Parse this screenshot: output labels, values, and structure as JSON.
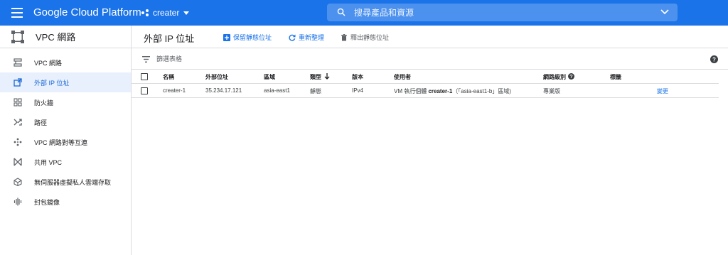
{
  "header": {
    "brand": "Google Cloud Platform",
    "project": "creater",
    "search_placeholder": "搜尋產品和資源"
  },
  "sidebar": {
    "title": "VPC 網路",
    "items": [
      {
        "label": "VPC 網路",
        "icon": "vpc-network-icon",
        "active": false
      },
      {
        "label": "外部 IP 位址",
        "icon": "external-ip-icon",
        "active": true
      },
      {
        "label": "防火牆",
        "icon": "firewall-icon",
        "active": false
      },
      {
        "label": "路徑",
        "icon": "routes-icon",
        "active": false
      },
      {
        "label": "VPC 網路對等互連",
        "icon": "vpc-peering-icon",
        "active": false
      },
      {
        "label": "共用 VPC",
        "icon": "shared-vpc-icon",
        "active": false
      },
      {
        "label": "無伺服器虛擬私人雲端存取",
        "icon": "serverless-vpc-access-icon",
        "active": false
      },
      {
        "label": "封包鏡像",
        "icon": "packet-mirroring-icon",
        "active": false
      }
    ]
  },
  "toolbar": {
    "page_title": "外部 IP 位址",
    "reserve_label": "保留靜態位址",
    "refresh_label": "重新整理",
    "release_label": "釋出靜態位址"
  },
  "filter": {
    "placeholder": "篩選表格"
  },
  "table": {
    "headers": {
      "name": "名稱",
      "external_address": "外部位址",
      "region": "區域",
      "type": "類型",
      "version": "版本",
      "used_by": "使用者",
      "network_tier": "網路級別",
      "labels": "標籤"
    },
    "rows": [
      {
        "name": "creater-1",
        "external_address": "35.234.17.121",
        "region": "asia-east1",
        "type": "靜態",
        "version": "IPv4",
        "used_by_prefix": "VM 執行個體",
        "used_by_instance": "creater-1",
        "used_by_suffix": "（「asia-east1-b」區域)",
        "network_tier": "專業版",
        "action": "變更"
      }
    ]
  },
  "colors": {
    "brand_blue": "#1a73e8",
    "active_bg": "#e8f0fe",
    "active_text": "#1967d2"
  }
}
